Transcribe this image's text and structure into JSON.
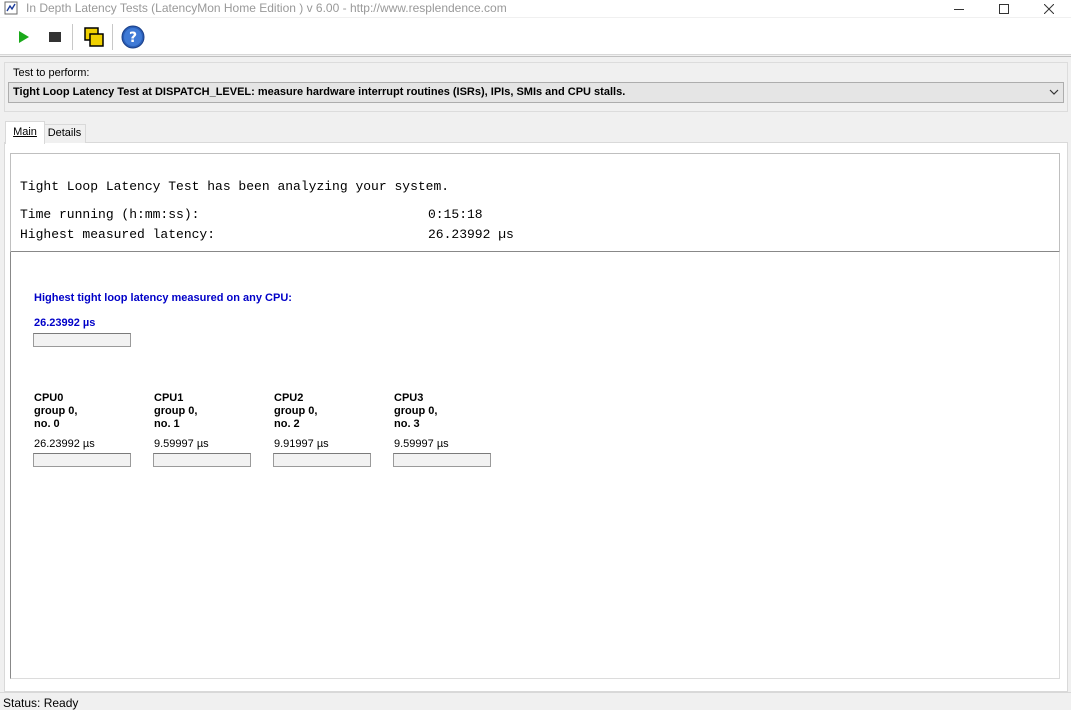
{
  "window": {
    "title": "In Depth Latency Tests  (LatencyMon Home Edition )  v 6.00 - http://www.resplendence.com",
    "minimize_icon": "minimize-icon",
    "maximize_icon": "maximize-icon",
    "close_icon": "close-icon"
  },
  "toolbar": {
    "buttons": [
      {
        "icon": "play-icon",
        "color": "#1aaa1a"
      },
      {
        "icon": "stop-icon",
        "color": "#333333"
      },
      {
        "icon": "windows-icon",
        "color": "#f0d000"
      },
      {
        "icon": "help-icon",
        "color": "#2a5fb8"
      }
    ]
  },
  "test": {
    "label": "Test to perform:",
    "selected": "Tight Loop Latency Test at DISPATCH_LEVEL:  measure hardware interrupt routines (ISRs), IPIs, SMIs and CPU stalls."
  },
  "tabs": [
    {
      "label": "Main",
      "active": true
    },
    {
      "label": "Details",
      "active": false
    }
  ],
  "summary": {
    "headline": "Tight Loop Latency Test has been analyzing your system.",
    "time_running_label": "Time running (h:mm:ss):",
    "time_running_value": "0:15:18",
    "highest_latency_label": "Highest measured latency:",
    "highest_latency_value": "26.23992 µs"
  },
  "overall": {
    "label": "Highest tight loop latency measured on any CPU:",
    "value": "26.23992 µs",
    "level": 0
  },
  "cpus": [
    {
      "name": "CPU0",
      "group": "group 0,",
      "no": "no. 0",
      "value": "26.23992 µs",
      "level": 0
    },
    {
      "name": "CPU1",
      "group": "group 0,",
      "no": "no. 1",
      "value": "9.59997 µs",
      "level": 0
    },
    {
      "name": "CPU2",
      "group": "group 0,",
      "no": "no. 2",
      "value": "9.91997 µs",
      "level": 0
    },
    {
      "name": "CPU3",
      "group": "group 0,",
      "no": "no. 3",
      "value": "9.59997 µs",
      "level": 0
    }
  ],
  "status": {
    "text": "Status: Ready"
  },
  "colors": {
    "accent_blue": "#0000c8",
    "progress_green": "#06b025"
  }
}
